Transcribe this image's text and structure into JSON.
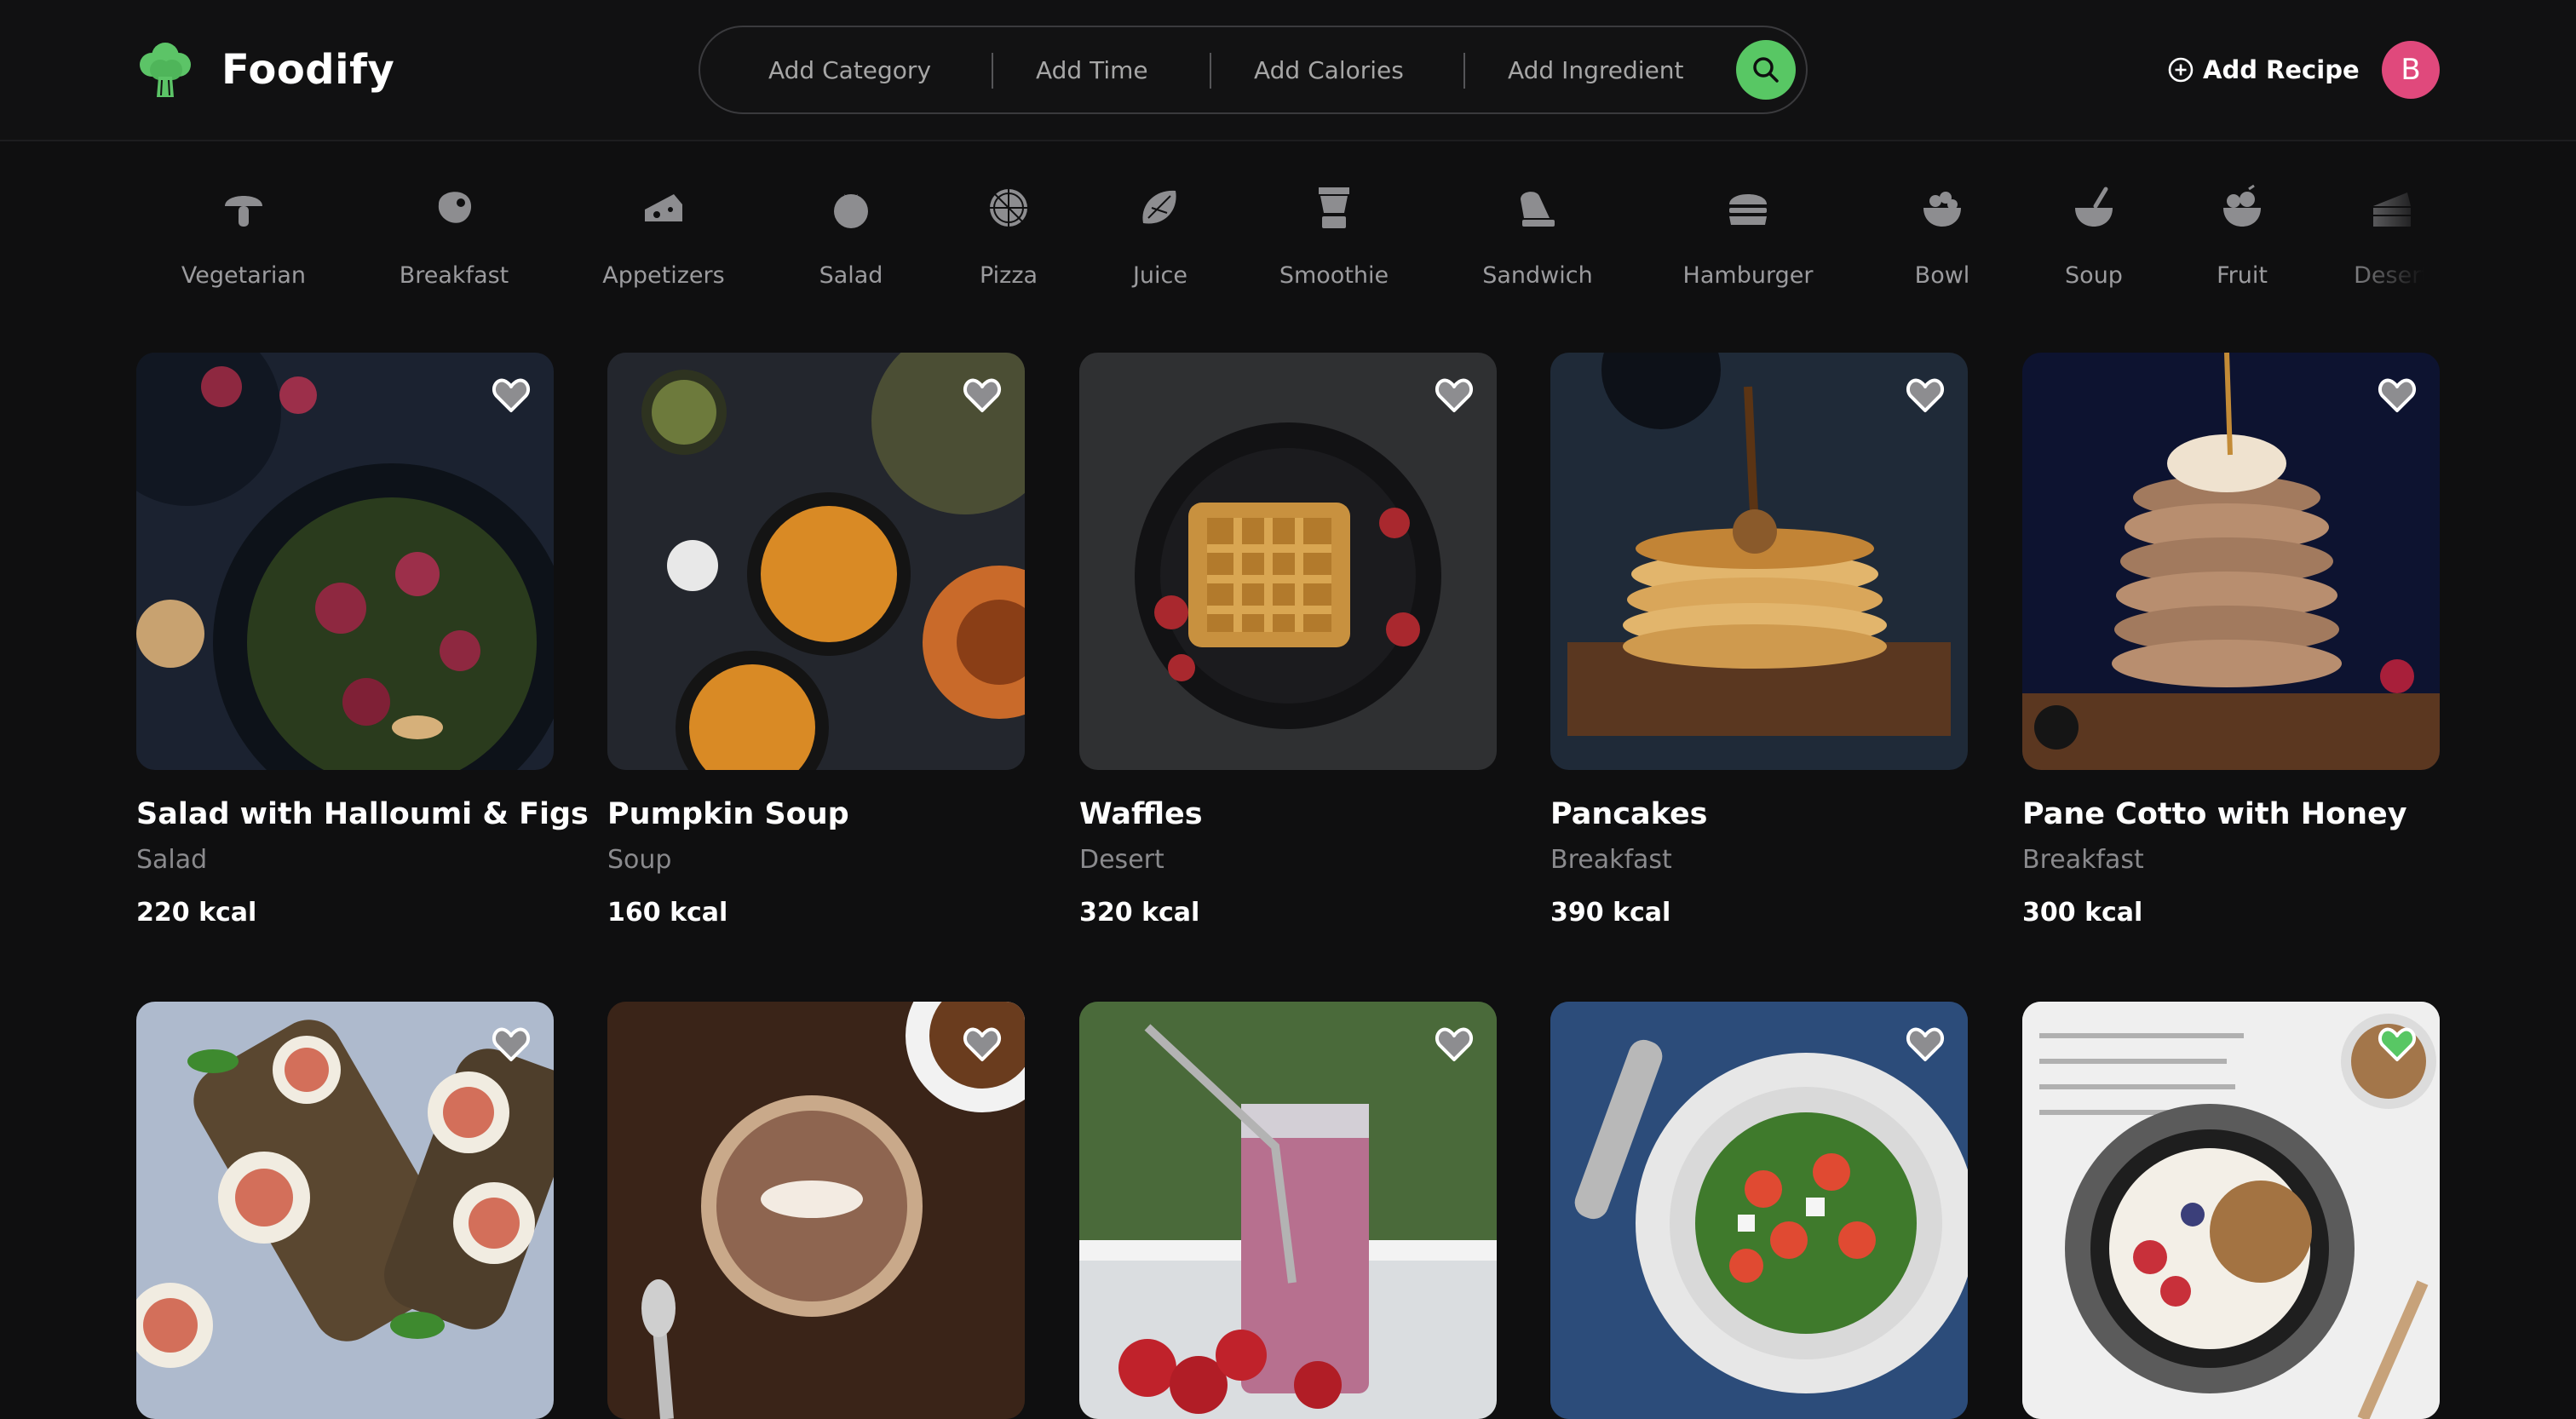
{
  "app": {
    "name": "Foodify"
  },
  "search": {
    "filters": [
      "Add Category",
      "Add Time",
      "Add Calories",
      "Add Ingredient"
    ]
  },
  "header": {
    "add_recipe_label": "Add Recipe",
    "avatar_initial": "B"
  },
  "categories": [
    {
      "label": "Vegetarian",
      "icon": "mushroom-icon"
    },
    {
      "label": "Breakfast",
      "icon": "steak-icon"
    },
    {
      "label": "Appetizers",
      "icon": "cheese-icon"
    },
    {
      "label": "Salad",
      "icon": "tomato-icon"
    },
    {
      "label": "Pizza",
      "icon": "pizza-icon"
    },
    {
      "label": "Juice",
      "icon": "lemon-icon"
    },
    {
      "label": "Smoothie",
      "icon": "blender-icon"
    },
    {
      "label": "Sandwich",
      "icon": "sandwich-icon"
    },
    {
      "label": "Hamburger",
      "icon": "burger-icon"
    },
    {
      "label": "Bowl",
      "icon": "bowl-icon"
    },
    {
      "label": "Soup",
      "icon": "soup-icon"
    },
    {
      "label": "Fruit",
      "icon": "fruit-bowl-icon"
    },
    {
      "label": "Desert",
      "icon": "cake-icon"
    }
  ],
  "recipes": [
    {
      "title": "Salad with Halloumi & Figs",
      "category": "Salad",
      "kcal": "220 kcal",
      "favorite": false
    },
    {
      "title": "Pumpkin Soup",
      "category": "Soup",
      "kcal": "160 kcal",
      "favorite": false
    },
    {
      "title": "Waffles",
      "category": "Desert",
      "kcal": "320 kcal",
      "favorite": false
    },
    {
      "title": "Pancakes",
      "category": "Breakfast",
      "kcal": "390 kcal",
      "favorite": false
    },
    {
      "title": "Pane Cotto with Honey",
      "category": "Breakfast",
      "kcal": "300 kcal",
      "favorite": false
    },
    {
      "title": "",
      "category": "",
      "kcal": "",
      "favorite": false
    },
    {
      "title": "",
      "category": "",
      "kcal": "",
      "favorite": false
    },
    {
      "title": "",
      "category": "",
      "kcal": "",
      "favorite": false
    },
    {
      "title": "",
      "category": "",
      "kcal": "",
      "favorite": false
    },
    {
      "title": "",
      "category": "",
      "kcal": "",
      "favorite": true
    }
  ],
  "colors": {
    "accent": "#58c764",
    "avatar": "#e0497c",
    "background": "#0f0f10"
  }
}
